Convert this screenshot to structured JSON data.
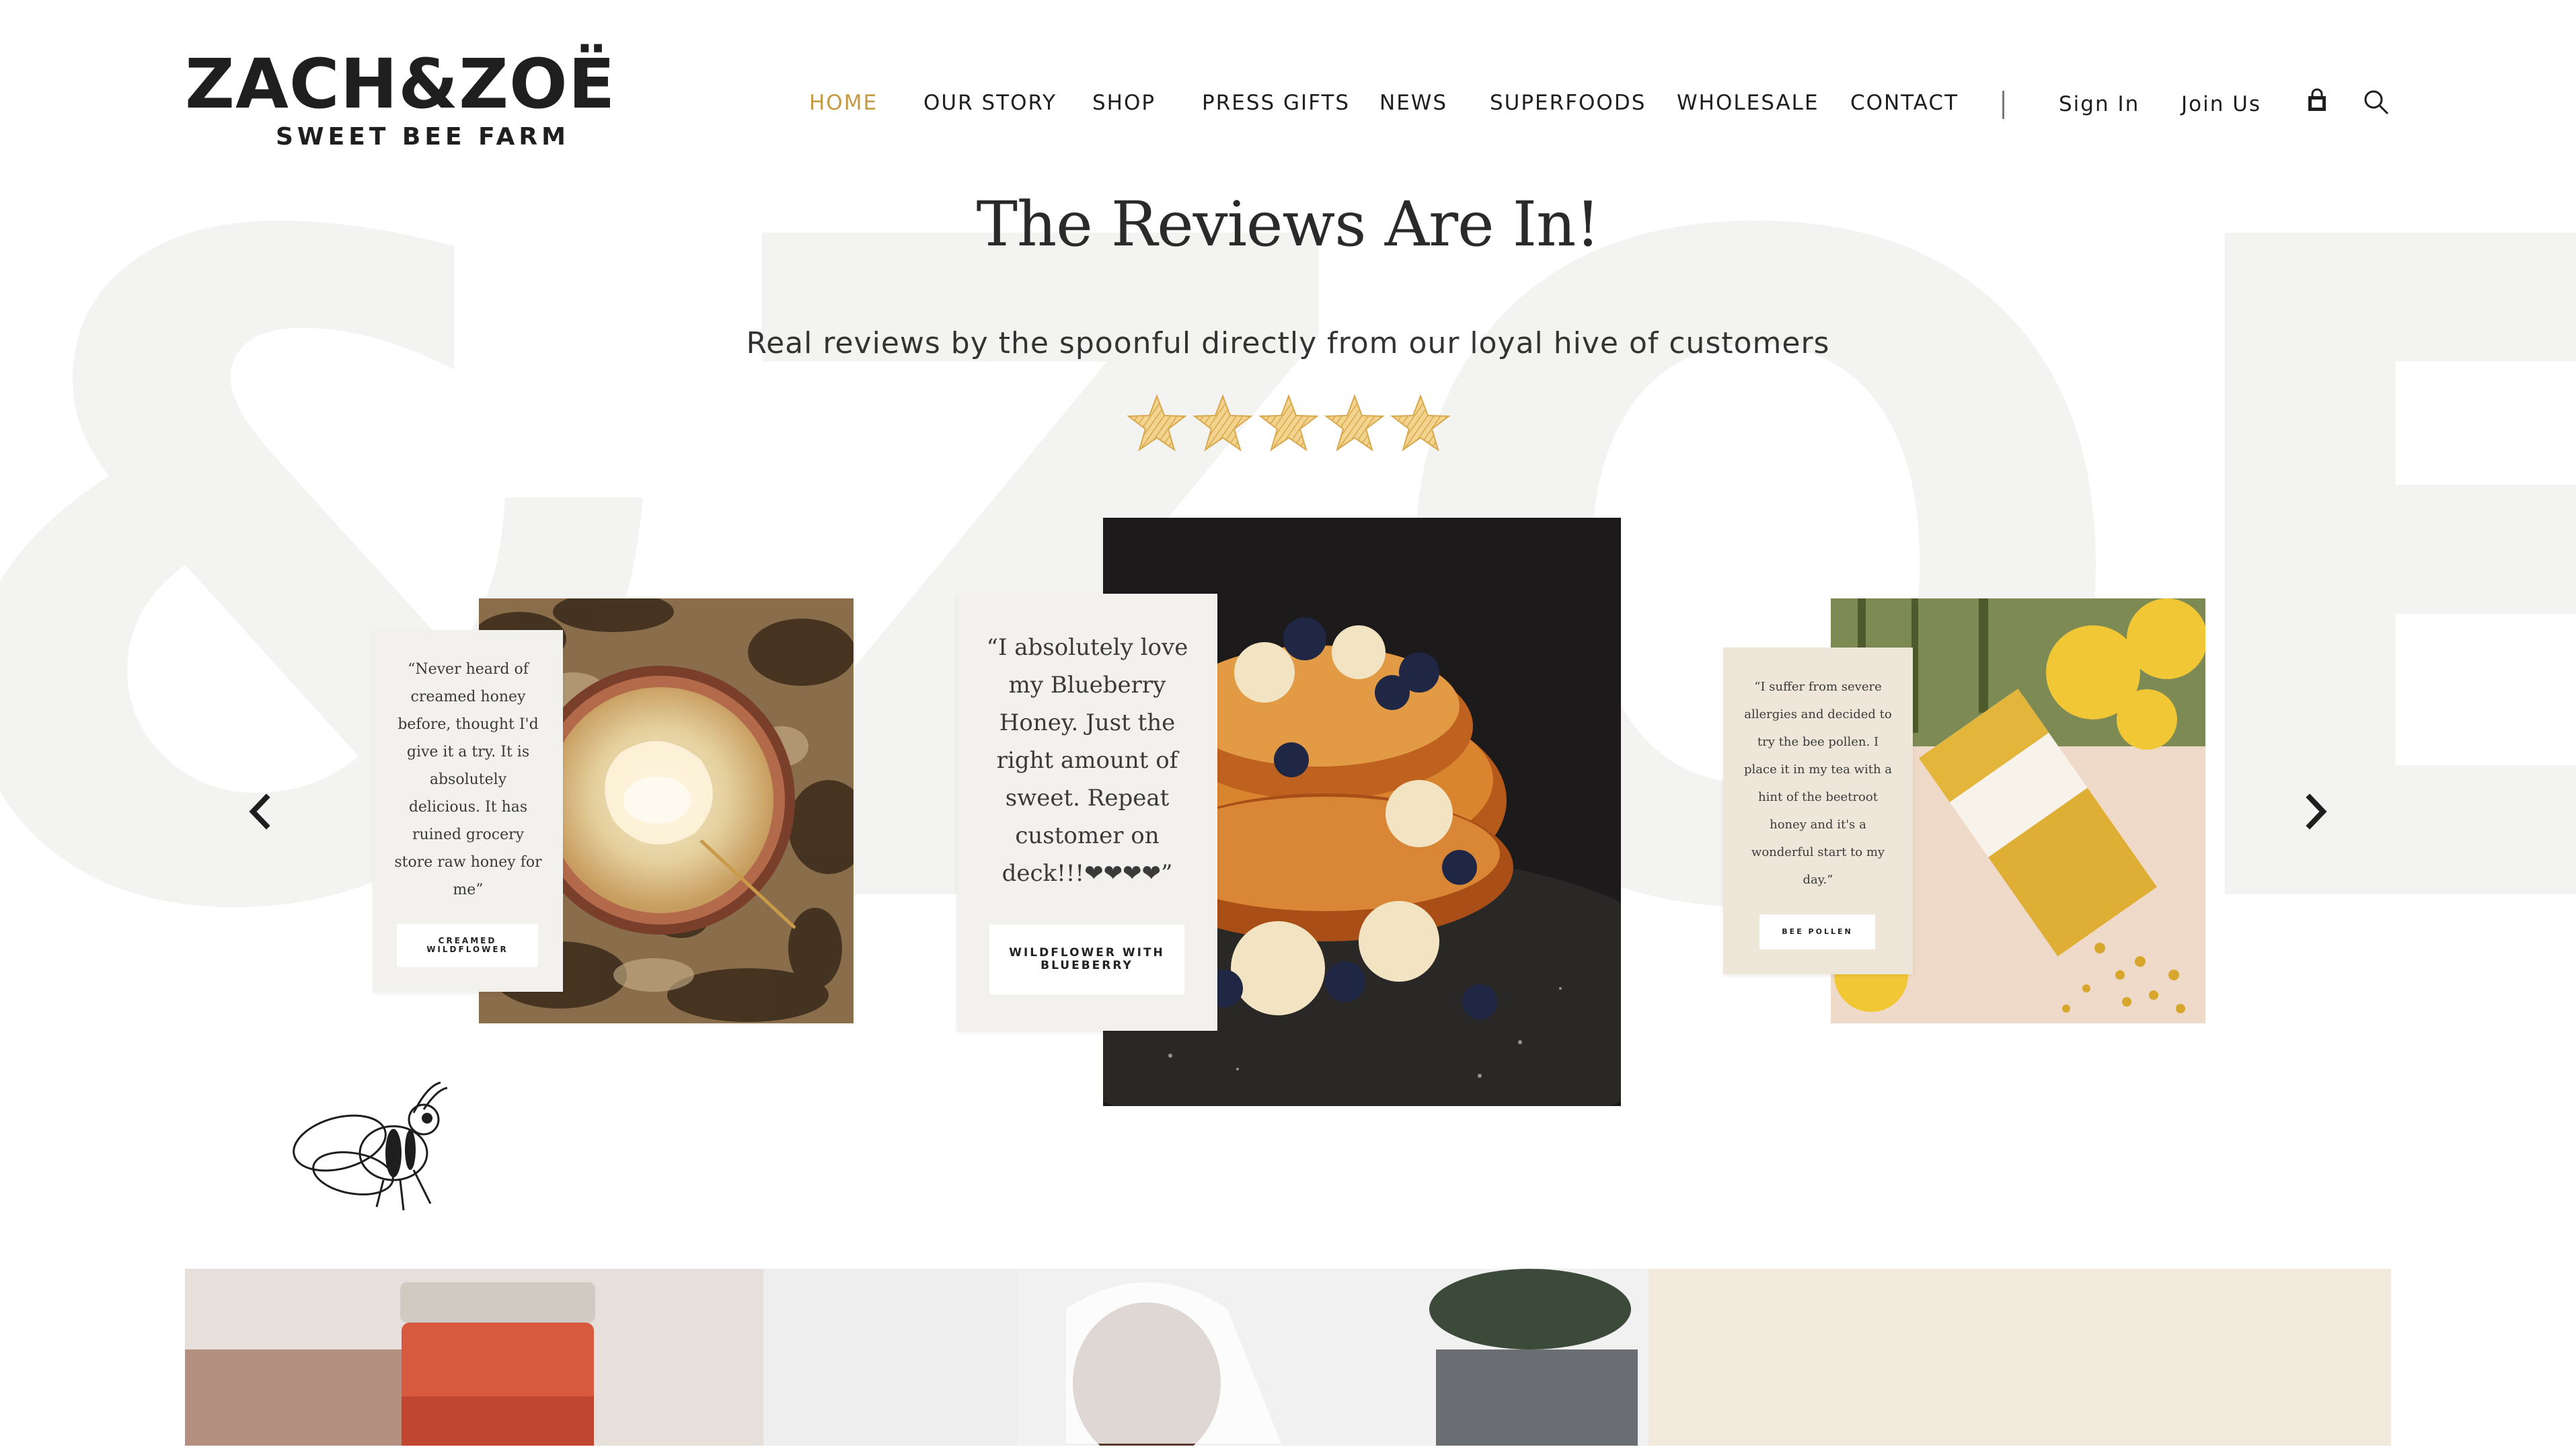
{
  "brand": {
    "name": "ZACH&ZOË",
    "tagline": "SWEET BEE FARM",
    "watermark_text": "&ZOE"
  },
  "nav": {
    "items": [
      {
        "label": "HOME",
        "active": true
      },
      {
        "label": "OUR STORY",
        "active": false
      },
      {
        "label": "SHOP",
        "active": false
      },
      {
        "label": "PRESS GIFTS",
        "active": false
      },
      {
        "label": "NEWS",
        "active": false
      },
      {
        "label": "SUPERFOODS",
        "active": false
      },
      {
        "label": "WHOLESALE",
        "active": false
      },
      {
        "label": "CONTACT",
        "active": false
      }
    ],
    "sign_in": "Sign In",
    "join_us": "Join Us",
    "icons": {
      "cart": "shopping-bag-icon",
      "search": "search-icon"
    }
  },
  "colors": {
    "accent": "#c49a44",
    "text": "#1e1e1e",
    "watermark": "#f3f3f2",
    "card_bg": "#f3f1ee",
    "card_bg_warm": "#efe6da",
    "star_gold": "#e8c16a",
    "cream_panel": "#f3e9dc"
  },
  "reviews_section": {
    "title": "The Reviews Are In!",
    "subtitle": "Real reviews by the spoonful directly from our loyal hive of customers",
    "rating": {
      "stars": 5,
      "max": 5
    },
    "reviews": [
      {
        "quote": "“Never heard of creamed honey before, thought I'd give it a try. It is absolutely delicious. It has ruined grocery store raw honey for me”",
        "product": "CREAMED WILDFLOWER"
      },
      {
        "quote": "“I absolutely love my Blueberry Honey. Just the right amount of sweet. Repeat customer on deck!!!❤❤❤❤”",
        "product": "WILDFLOWER WITH BLUEBERRY"
      },
      {
        "quote": "“I suffer from severe allergies and decided to try the bee pollen. I place it in my tea with a hint of the beetroot honey and it's a wonderful start to my day.”",
        "product": "BEE POLLEN"
      }
    ],
    "prev_icon": "chevron-left-icon",
    "next_icon": "chevron-right-icon"
  },
  "decor": {
    "bee_icon": "bee-illustration-icon"
  }
}
